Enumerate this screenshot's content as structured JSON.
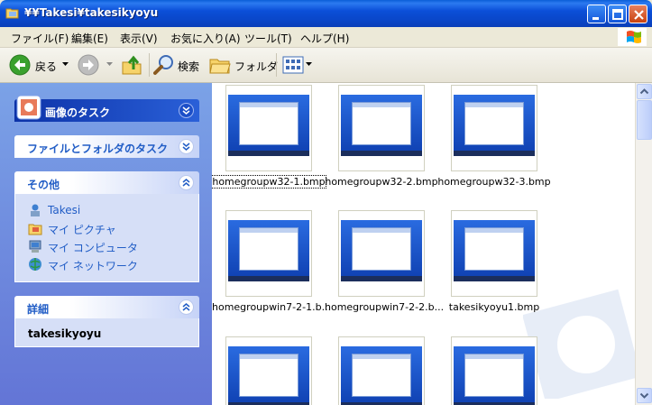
{
  "window": {
    "title": "¥¥Takesi¥takesikyoyu"
  },
  "menu": [
    "ファイル(F)",
    "編集(E)",
    "表示(V)",
    "お気に入り(A)",
    "ツール(T)",
    "ヘルプ(H)"
  ],
  "toolbar": {
    "back_label": "戻る",
    "search_label": "検索",
    "folders_label": "フォルダ"
  },
  "taskpane": {
    "picture_tasks": {
      "title": "画像のタスク"
    },
    "file_tasks": {
      "title": "ファイルとフォルダのタスク"
    },
    "other": {
      "title": "その他",
      "links": [
        {
          "label": "Takesi",
          "icon": "user-folder-icon"
        },
        {
          "label": "マイ ピクチャ",
          "icon": "my-pictures-icon"
        },
        {
          "label": "マイ コンピュータ",
          "icon": "my-computer-icon"
        },
        {
          "label": "マイ ネットワーク",
          "icon": "my-network-icon"
        }
      ]
    },
    "details": {
      "title": "詳細",
      "name": "takesikyoyu"
    }
  },
  "files": [
    {
      "name": "homegroupw32-1.bmp",
      "selected": true
    },
    {
      "name": "homegroupw32-2.bmp",
      "selected": false
    },
    {
      "name": "homegroupw32-3.bmp",
      "selected": false
    },
    {
      "name": "homegroupwin7-2-1.b...",
      "selected": false
    },
    {
      "name": "homegroupwin7-2-2.b...",
      "selected": false
    },
    {
      "name": "takesikyoyu1.bmp",
      "selected": false
    },
    {
      "name": "",
      "selected": false
    },
    {
      "name": "",
      "selected": false
    },
    {
      "name": "",
      "selected": false
    }
  ],
  "colors": {
    "titlebar": "#0A46C8",
    "link": "#215DC6",
    "taskpane": "#7BA2E7"
  }
}
